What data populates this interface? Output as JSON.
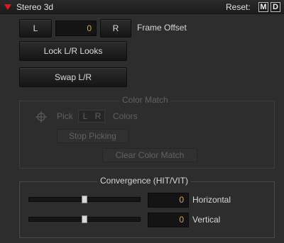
{
  "header": {
    "title": "Stereo 3d",
    "reset_label": "Reset:",
    "reset_m": "M",
    "reset_d": "D"
  },
  "frame_offset": {
    "left_label": "L",
    "value": "0",
    "right_label": "R",
    "label": "Frame Offset"
  },
  "buttons": {
    "lock_looks": "Lock L/R Looks",
    "swap": "Swap L/R"
  },
  "color_match": {
    "title": "Color Match",
    "pick_label": "Pick",
    "pick_l": "L",
    "pick_r": "R",
    "colors_label": "Colors",
    "stop_picking": "Stop Picking",
    "clear": "Clear Color Match",
    "enabled": false
  },
  "convergence": {
    "title": "Convergence (HIT/VIT)",
    "horizontal": {
      "label": "Horizontal",
      "value": "0",
      "slider_fraction": 0.5
    },
    "vertical": {
      "label": "Vertical",
      "value": "0",
      "slider_fraction": 0.5
    }
  },
  "colors": {
    "accent_value": "#e1a33a",
    "collapse_arrow": "#d22020"
  }
}
